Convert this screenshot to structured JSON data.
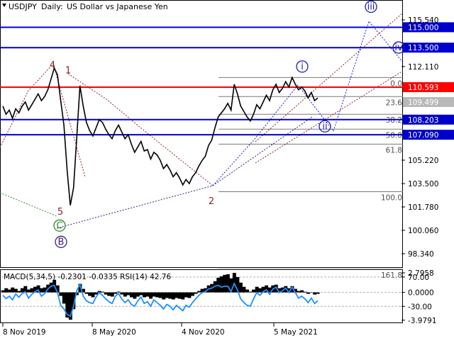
{
  "header": {
    "symbol": "USDJPY",
    "timeframe": "Daily:",
    "description": "US Dollar vs Japanese Yen"
  },
  "colors": {
    "price_line": "#000000",
    "resistance_red": "#ff0000",
    "support_blue": "#0000cc",
    "fib_gray": "#9a9a9a",
    "wave_brown": "#8b2323",
    "wave_blue": "#1a1acc",
    "wave_green": "#2e8b2e",
    "wave_purple": "#3c1e7a",
    "macd_hist": "#000000",
    "rsi_line": "#1e90ff"
  },
  "chart_data": [
    {
      "type": "line",
      "title": "USDJPY, Daily: US Dollar vs Japanese Yen",
      "x_ticks": [
        "8 Nov 2019",
        "8 May 2020",
        "4 Nov 2020",
        "5 May 2021"
      ],
      "y_ticks": [
        115.54,
        113.5,
        112.11,
        110.593,
        109.499,
        108.203,
        107.09,
        105.22,
        103.5,
        101.78,
        100.06,
        98.34
      ],
      "ylim": [
        97.4,
        116.9
      ],
      "series": [
        {
          "values": [
            109.2,
            108.6,
            108.9,
            108.3,
            109.0,
            108.7,
            109.2,
            109.5,
            108.9,
            109.3,
            109.7,
            110.1,
            109.6,
            109.9,
            110.4,
            111.2,
            112.0,
            111.5,
            109.6,
            107.8,
            104.5,
            101.9,
            103.2,
            106.9,
            110.7,
            109.2,
            108.0,
            107.4,
            107.0,
            107.6,
            108.2,
            108.0,
            107.5,
            107.1,
            106.8,
            107.4,
            107.8,
            107.3,
            106.8,
            107.1,
            106.4,
            105.8,
            106.2,
            106.6,
            105.9,
            106.0,
            105.3,
            105.8,
            105.6,
            105.2,
            104.6,
            104.9,
            104.5,
            104.0,
            104.3,
            103.9,
            103.4,
            103.8,
            103.5,
            104.0,
            104.3,
            104.8,
            105.2,
            105.5,
            106.3,
            106.7,
            107.6,
            108.4,
            108.7,
            109.0,
            109.4,
            108.9,
            110.8,
            110.1,
            109.2,
            108.8,
            108.4,
            108.1,
            108.6,
            109.3,
            109.0,
            109.5,
            110.0,
            109.6,
            110.4,
            110.8,
            110.2,
            110.5,
            111.0,
            110.6,
            111.3,
            110.8,
            110.4,
            110.6,
            110.3,
            109.8,
            110.2,
            109.6,
            109.8
          ]
        }
      ],
      "resistance_levels": [
        {
          "value": 115.0,
          "label": "115.000"
        },
        {
          "value": 113.5,
          "label": "113.500"
        },
        {
          "value": 110.593,
          "label": "110.593"
        },
        {
          "value": 109.499,
          "label": "109.499"
        },
        {
          "value": 108.203,
          "label": "108.203"
        },
        {
          "value": 107.09,
          "label": "107.090"
        }
      ],
      "fibonacci": [
        {
          "label": "0.0",
          "value": 111.3
        },
        {
          "label": "23.6",
          "value": 109.9
        },
        {
          "label": "38.2",
          "value": 108.6
        },
        {
          "label": "50.0",
          "value": 107.5
        },
        {
          "label": "61.8",
          "value": 106.4
        },
        {
          "label": "100.0",
          "value": 102.9
        },
        {
          "label": "161.8",
          "value": 97.2
        }
      ],
      "wave_labels": [
        {
          "text": "4",
          "value": 112.0
        },
        {
          "text": "1",
          "value": 111.6
        },
        {
          "text": "5",
          "value": 101.2
        },
        {
          "text": "C",
          "value": 100.2
        },
        {
          "text": "B",
          "value": 99.0
        },
        {
          "text": "2",
          "value": 102.0
        },
        {
          "text": "i",
          "value": 111.9
        },
        {
          "text": "ii",
          "value": 107.5
        },
        {
          "text": "iii",
          "value": 116.3
        },
        {
          "text": "iv",
          "value": 113.3
        }
      ]
    },
    {
      "type": "bar",
      "title": "MACD(5,34,5) -0.2301 -0.0335 RSI(14) 42.76",
      "y_ticks": [
        2.7958,
        70.0,
        0.0,
        -30.0,
        -3.9791
      ],
      "ylim": [
        -4.2,
        3.1
      ],
      "values": [
        0.3,
        0.6,
        0.4,
        0.7,
        0.5,
        0.2,
        0.6,
        0.9,
        0.4,
        0.6,
        0.8,
        1.0,
        0.6,
        0.7,
        1.1,
        1.4,
        1.8,
        1.0,
        -0.5,
        -1.6,
        -3.6,
        -3.9,
        -2.4,
        -0.4,
        1.2,
        0.5,
        -0.2,
        -0.5,
        -0.7,
        -0.3,
        0.2,
        0.1,
        -0.3,
        -0.5,
        -0.6,
        -0.2,
        0.1,
        -0.3,
        -0.6,
        -0.4,
        -0.7,
        -0.9,
        -0.6,
        -0.4,
        -0.7,
        -0.6,
        -0.9,
        -0.6,
        -0.7,
        -0.8,
        -1.0,
        -0.8,
        -0.9,
        -1.0,
        -0.8,
        -0.9,
        -1.0,
        -0.7,
        -0.8,
        -0.5,
        -0.2,
        0.2,
        0.5,
        0.6,
        1.0,
        1.2,
        1.6,
        2.1,
        2.3,
        2.5,
        2.6,
        2.0,
        2.8,
        2.2,
        1.4,
        0.8,
        0.4,
        0.1,
        0.4,
        0.8,
        0.6,
        0.8,
        1.0,
        0.7,
        1.0,
        1.1,
        0.6,
        0.7,
        0.9,
        0.6,
        0.9,
        0.5,
        0.2,
        0.3,
        0.1,
        -0.2,
        0.0,
        -0.3,
        -0.2
      ],
      "rsi_values": [
        52,
        45,
        50,
        42,
        55,
        48,
        56,
        60,
        46,
        54,
        60,
        64,
        50,
        56,
        66,
        72,
        74,
        58,
        30,
        22,
        10,
        6,
        28,
        62,
        76,
        50,
        40,
        36,
        34,
        48,
        58,
        52,
        44,
        38,
        34,
        50,
        56,
        44,
        36,
        42,
        32,
        28,
        40,
        48,
        34,
        38,
        28,
        42,
        36,
        30,
        22,
        32,
        28,
        20,
        30,
        24,
        18,
        30,
        26,
        36,
        44,
        52,
        58,
        60,
        66,
        68,
        72,
        74,
        70,
        72,
        72,
        60,
        78,
        64,
        44,
        36,
        30,
        28,
        44,
        58,
        52,
        60,
        64,
        54,
        66,
        70,
        58,
        62,
        68,
        58,
        70,
        58,
        46,
        50,
        44,
        36,
        46,
        34,
        40
      ]
    }
  ]
}
